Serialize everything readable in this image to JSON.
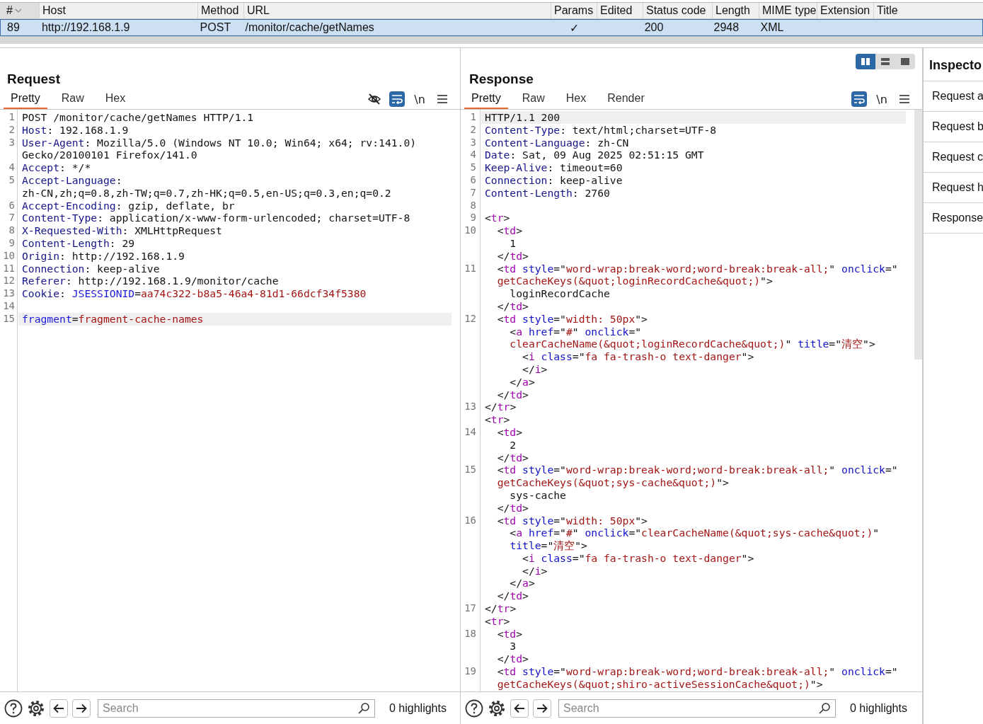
{
  "table": {
    "columns": [
      {
        "label": "#",
        "sorted": true
      },
      {
        "label": "Host",
        "sorted": false
      },
      {
        "label": "Method",
        "sorted": false
      },
      {
        "label": "URL",
        "sorted": false
      },
      {
        "label": "Params",
        "sorted": false
      },
      {
        "label": "Edited",
        "sorted": false
      },
      {
        "label": "Status code",
        "sorted": false
      },
      {
        "label": "Length",
        "sorted": false
      },
      {
        "label": "MIME type",
        "sorted": false
      },
      {
        "label": "Extension",
        "sorted": false
      },
      {
        "label": "Title",
        "sorted": false
      }
    ],
    "rows": [
      {
        "selected": true,
        "number": "89",
        "host": "http://192.168.1.9",
        "method": "POST",
        "url": "/monitor/cache/getNames",
        "params": "✓",
        "status_code": "200",
        "length": "2948",
        "mime_type": "XML"
      }
    ]
  },
  "request": {
    "title": "Request",
    "tabs": [
      {
        "label": "Pretty",
        "selected": true
      },
      {
        "label": "Raw",
        "selected": false
      },
      {
        "label": "Hex",
        "selected": false
      }
    ],
    "tools": [
      {
        "kind": "hide",
        "on": false
      },
      {
        "kind": "wrap",
        "on": true
      },
      {
        "kind": "newline",
        "label": "\\n",
        "on": false
      },
      {
        "kind": "menu",
        "on": false
      }
    ],
    "lines": [
      {
        "number": "1",
        "kind": "start",
        "highlighted": false,
        "rows": [
          "POST /monitor/cache/getNames HTTP/1.1"
        ]
      },
      {
        "number": "2",
        "kind": "header",
        "highlighted": false,
        "rows": [
          "Host: 192.168.1.9"
        ]
      },
      {
        "number": "3",
        "kind": "header",
        "highlighted": false,
        "rows": [
          "User-Agent: Mozilla/5.0 (Windows NT 10.0; Win64; x64; rv:141.0)",
          "Gecko/20100101 Firefox/141.0"
        ]
      },
      {
        "number": "4",
        "kind": "header",
        "highlighted": false,
        "rows": [
          "Accept: */*"
        ]
      },
      {
        "number": "5",
        "kind": "header",
        "highlighted": false,
        "rows": [
          "Accept-Language:",
          "zh-CN,zh;q=0.8,zh-TW;q=0.7,zh-HK;q=0.5,en-US;q=0.3,en;q=0.2"
        ]
      },
      {
        "number": "6",
        "kind": "header",
        "highlighted": false,
        "rows": [
          "Accept-Encoding: gzip, deflate, br"
        ]
      },
      {
        "number": "7",
        "kind": "header",
        "highlighted": false,
        "rows": [
          "Content-Type: application/x-www-form-urlencoded; charset=UTF-8"
        ]
      },
      {
        "number": "8",
        "kind": "header",
        "highlighted": false,
        "rows": [
          "X-Requested-With: XMLHttpRequest"
        ]
      },
      {
        "number": "9",
        "kind": "header",
        "highlighted": false,
        "rows": [
          "Content-Length: 29"
        ]
      },
      {
        "number": "10",
        "kind": "header",
        "highlighted": false,
        "rows": [
          "Origin: http://192.168.1.9"
        ]
      },
      {
        "number": "11",
        "kind": "header",
        "highlighted": false,
        "rows": [
          "Connection: keep-alive"
        ]
      },
      {
        "number": "12",
        "kind": "header",
        "highlighted": false,
        "rows": [
          "Referer: http://192.168.1.9/monitor/cache"
        ]
      },
      {
        "number": "13",
        "kind": "cookie",
        "highlighted": false,
        "rows": [
          "Cookie: JSESSIONID=aa74c322-b8a5-46a4-81d1-66dcf34f5380"
        ]
      },
      {
        "number": "14",
        "kind": "blank",
        "highlighted": false
      },
      {
        "number": "15",
        "kind": "form",
        "highlighted": true,
        "rows": [
          "fragment=fragment-cache-names"
        ]
      }
    ],
    "search": {
      "placeholder": "Search"
    },
    "highlights": "0 highlights"
  },
  "response": {
    "title": "Response",
    "layout_buttons": [
      {
        "kind": "columns",
        "selected": true
      },
      {
        "kind": "rows",
        "selected": false
      },
      {
        "kind": "single",
        "selected": false
      }
    ],
    "tabs": [
      {
        "label": "Pretty",
        "selected": true
      },
      {
        "label": "Raw",
        "selected": false
      },
      {
        "label": "Hex",
        "selected": false
      },
      {
        "label": "Render",
        "selected": false
      }
    ],
    "tools": [
      {
        "kind": "wrap",
        "on": true
      },
      {
        "kind": "newline",
        "label": "\\n",
        "on": false
      },
      {
        "kind": "menu",
        "on": false
      }
    ],
    "lines": [
      {
        "number": "1",
        "kind": "start",
        "highlighted": true,
        "rows": [
          "HTTP/1.1 200"
        ]
      },
      {
        "number": "2",
        "kind": "header",
        "highlighted": false,
        "rows": [
          "Content-Type: text/html;charset=UTF-8"
        ]
      },
      {
        "number": "3",
        "kind": "header",
        "highlighted": false,
        "rows": [
          "Content-Language: zh-CN"
        ]
      },
      {
        "number": "4",
        "kind": "header",
        "highlighted": false,
        "rows": [
          "Date: Sat, 09 Aug 2025 02:51:15 GMT"
        ]
      },
      {
        "number": "5",
        "kind": "header",
        "highlighted": false,
        "rows": [
          "Keep-Alive: timeout=60"
        ]
      },
      {
        "number": "6",
        "kind": "header",
        "highlighted": false,
        "rows": [
          "Connection: keep-alive"
        ]
      },
      {
        "number": "7",
        "kind": "header",
        "highlighted": false,
        "rows": [
          "Content-Length: 2760"
        ]
      },
      {
        "number": "8",
        "kind": "blank",
        "highlighted": false
      },
      {
        "number": "9",
        "kind": "markup",
        "highlighted": false,
        "rows": [
          "<tr>"
        ]
      },
      {
        "number": "10",
        "kind": "markup",
        "highlighted": false,
        "rows": [
          "  <td>",
          "    1",
          "  </td>"
        ]
      },
      {
        "number": "11",
        "kind": "markup",
        "highlighted": false,
        "rows": [
          "  <td style=\"word-wrap:break-word;word-break:break-all;\" onclick=\"",
          "  getCacheKeys(&quot;loginRecordCache&quot;)\">",
          "    loginRecordCache",
          "  </td>"
        ]
      },
      {
        "number": "12",
        "kind": "markup",
        "highlighted": false,
        "rows": [
          "  <td style=\"width: 50px\">",
          "    <a href=\"#\" onclick=\"",
          "    clearCacheName(&quot;loginRecordCache&quot;)\" title=\"清空\">",
          "      <i class=\"fa fa-trash-o text-danger\">",
          "      </i>",
          "    </a>",
          "  </td>"
        ]
      },
      {
        "number": "13",
        "kind": "markup",
        "highlighted": false,
        "rows": [
          "</tr>",
          "<tr>"
        ]
      },
      {
        "number": "14",
        "kind": "markup",
        "highlighted": false,
        "rows": [
          "  <td>",
          "    2",
          "  </td>"
        ]
      },
      {
        "number": "15",
        "kind": "markup",
        "highlighted": false,
        "rows": [
          "  <td style=\"word-wrap:break-word;word-break:break-all;\" onclick=\"",
          "  getCacheKeys(&quot;sys-cache&quot;)\">",
          "    sys-cache",
          "  </td>"
        ]
      },
      {
        "number": "16",
        "kind": "markup",
        "highlighted": false,
        "rows": [
          "  <td style=\"width: 50px\">",
          "    <a href=\"#\" onclick=\"clearCacheName(&quot;sys-cache&quot;)\"",
          "    title=\"清空\">",
          "      <i class=\"fa fa-trash-o text-danger\">",
          "      </i>",
          "    </a>",
          "  </td>"
        ]
      },
      {
        "number": "17",
        "kind": "markup",
        "highlighted": false,
        "rows": [
          "</tr>",
          "<tr>"
        ]
      },
      {
        "number": "18",
        "kind": "markup",
        "highlighted": false,
        "rows": [
          "  <td>",
          "    3",
          "  </td>"
        ]
      },
      {
        "number": "19",
        "kind": "markup",
        "highlighted": false,
        "rows": [
          "  <td style=\"word-wrap:break-word;word-break:break-all;\" onclick=\"",
          "  getCacheKeys(&quot;shiro-activeSessionCache&quot;)\">"
        ]
      }
    ],
    "search": {
      "placeholder": "Search"
    },
    "highlights": "0 highlights"
  },
  "inspector": {
    "title": "Inspecto",
    "items": [
      "Request a",
      "Request b",
      "Request c",
      "Request h",
      "Response"
    ]
  }
}
